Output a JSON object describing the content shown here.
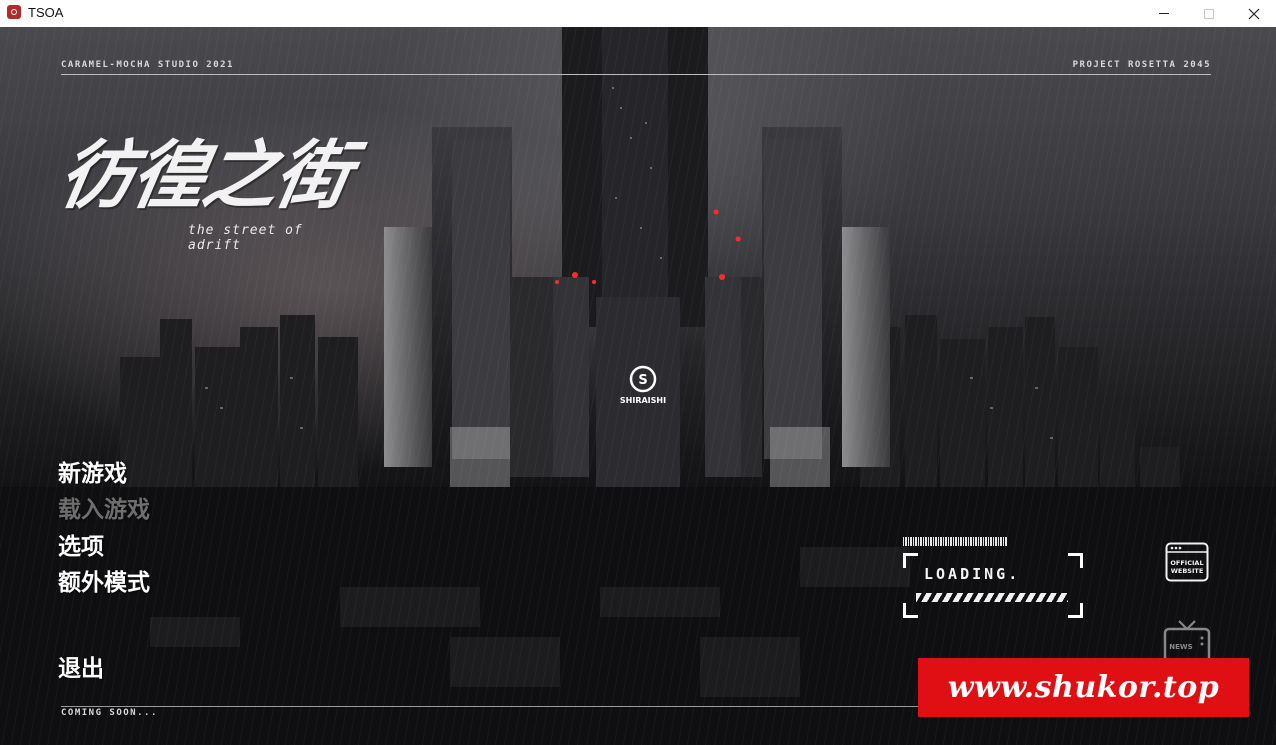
{
  "window": {
    "title": "TSOA",
    "icon": "app-icon",
    "controls": [
      "minimize-icon",
      "maximize-icon",
      "close-icon"
    ]
  },
  "header": {
    "left_text": "CARAMEL-MOCHA STUDIO 2021",
    "right_text": "PROJECT ROSETTA 2045"
  },
  "logo": {
    "title_cn": "彷徨之街",
    "subtitle_en": "the street of adrift"
  },
  "scene": {
    "tower_sign": "SHIRAISHI"
  },
  "menu": {
    "items": [
      {
        "label": "新游戏",
        "enabled": true
      },
      {
        "label": "载入游戏",
        "enabled": false
      },
      {
        "label": "选项",
        "enabled": true
      },
      {
        "label": "额外模式",
        "enabled": true
      },
      {
        "label": "退出",
        "enabled": true
      }
    ]
  },
  "loading": {
    "label": "LOADING."
  },
  "side_buttons": {
    "official": {
      "line1": "OFFICIAL",
      "line2": "WEBSITE",
      "icon": "browser-icon"
    },
    "news": {
      "label": "NEWS",
      "icon": "tv-icon"
    }
  },
  "footer": {
    "text": "COMING SOON..."
  },
  "watermark": {
    "text": "www.shukor.top"
  },
  "colors": {
    "watermark_bg": "#e00f14",
    "accent_red_lights": "#ff2a2a",
    "menu_enabled": "#ffffff",
    "menu_disabled": "#6e6e6e"
  }
}
